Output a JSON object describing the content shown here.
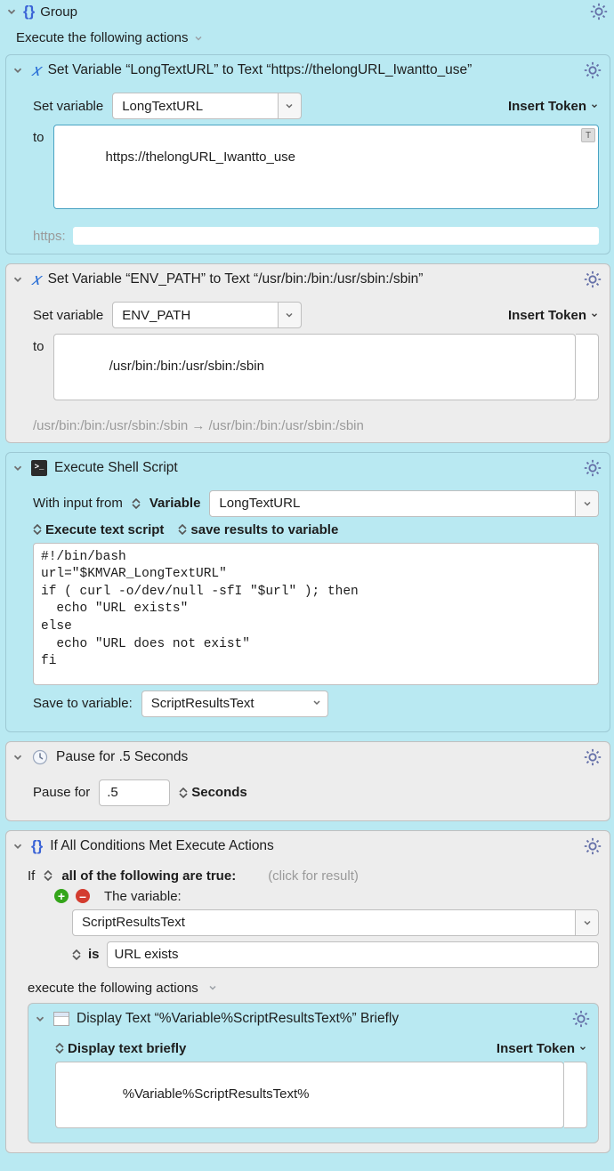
{
  "group": {
    "title": "Group",
    "subtitle": "Execute the following actions"
  },
  "tokens": {
    "insert": "Insert Token"
  },
  "actions": {
    "setvar1": {
      "title": "Set Variable “LongTextURL” to Text “https://thelongURL_Iwantto_use”",
      "lbl_setvar": "Set variable",
      "var": "LongTextURL",
      "lbl_to": "to",
      "value": "https://thelongURL_Iwantto_use",
      "footnote_prefix": "https:"
    },
    "setvar2": {
      "title": "Set Variable “ENV_PATH” to Text “/usr/bin:/bin:/usr/sbin:/sbin”",
      "lbl_setvar": "Set variable",
      "var": "ENV_PATH",
      "lbl_to": "to",
      "value": "/usr/bin:/bin:/usr/sbin:/sbin",
      "footnote": "/usr/bin:/bin:/usr/sbin:/sbin  →  /usr/bin:/bin:/usr/sbin:/sbin"
    },
    "shell": {
      "title": "Execute Shell Script",
      "lbl_input": "With input from",
      "input_source": "Variable",
      "input_var": "LongTextURL",
      "mode1": "Execute text script",
      "mode2": "save results to variable",
      "script": "#!/bin/bash\nurl=\"$KMVAR_LongTextURL\"\nif ( curl -o/dev/null -sfI \"$url\" ); then\n  echo \"URL exists\"\nelse\n  echo \"URL does not exist\"\nfi",
      "lbl_saveto": "Save to variable:",
      "save_var": "ScriptResultsText"
    },
    "pause": {
      "title": "Pause for .5 Seconds",
      "lbl": "Pause for",
      "value": ".5",
      "unit": "Seconds"
    },
    "ifblock": {
      "title": "If All Conditions Met Execute Actions",
      "lbl_if": "If",
      "mode": "all of the following are true:",
      "result_hint": "(click for result)",
      "cond_label": "The variable:",
      "cond_var": "ScriptResultsText",
      "cond_op": "is",
      "cond_value": "URL exists",
      "exec_label": "execute the following actions",
      "display": {
        "title": "Display Text “%Variable%ScriptResultsText%” Briefly",
        "mode": "Display text briefly",
        "value": "%Variable%ScriptResultsText%"
      }
    }
  }
}
